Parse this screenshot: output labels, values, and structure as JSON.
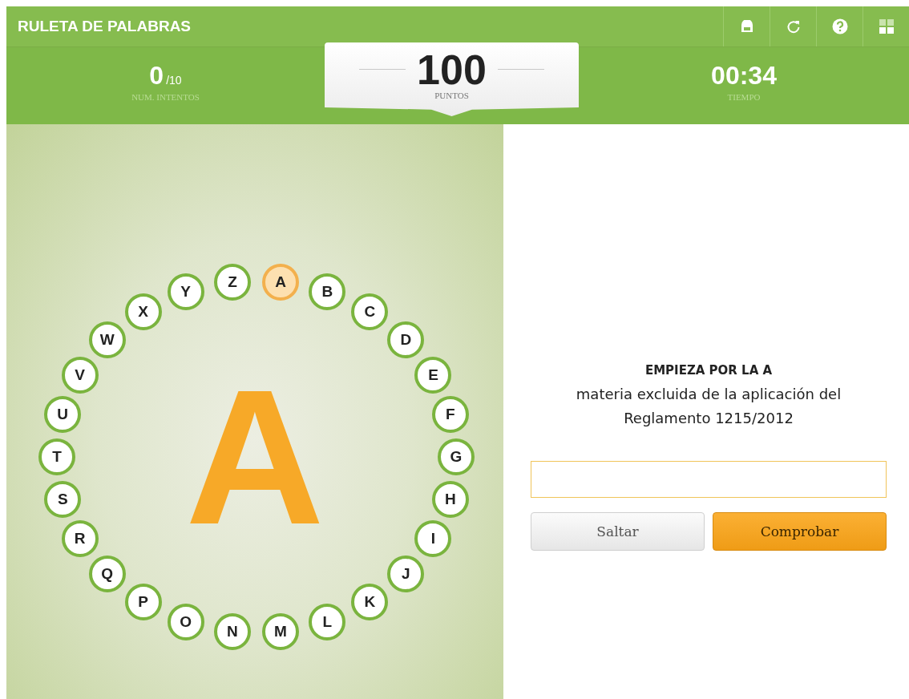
{
  "header": {
    "title": "RULETA DE PALABRAS",
    "tools": [
      {
        "kind": "print"
      },
      {
        "kind": "restart"
      },
      {
        "kind": "help"
      },
      {
        "kind": "menu"
      }
    ]
  },
  "stats": {
    "attempts": {
      "value": "0",
      "total": "/10",
      "label": "NUM. INTENTOS"
    },
    "score": {
      "value": "100",
      "label": "PUNTOS"
    },
    "time": {
      "value": "00:34",
      "label": "TIEMPO"
    }
  },
  "wheel": {
    "current_letter": "A",
    "letters": [
      {
        "letter": "A",
        "selected": true
      },
      {
        "letter": "B",
        "selected": false
      },
      {
        "letter": "C",
        "selected": false
      },
      {
        "letter": "D",
        "selected": false
      },
      {
        "letter": "E",
        "selected": false
      },
      {
        "letter": "F",
        "selected": false
      },
      {
        "letter": "G",
        "selected": false
      },
      {
        "letter": "H",
        "selected": false
      },
      {
        "letter": "I",
        "selected": false
      },
      {
        "letter": "J",
        "selected": false
      },
      {
        "letter": "K",
        "selected": false
      },
      {
        "letter": "L",
        "selected": false
      },
      {
        "letter": "M",
        "selected": false
      },
      {
        "letter": "N",
        "selected": false
      },
      {
        "letter": "O",
        "selected": false
      },
      {
        "letter": "P",
        "selected": false
      },
      {
        "letter": "Q",
        "selected": false
      },
      {
        "letter": "R",
        "selected": false
      },
      {
        "letter": "S",
        "selected": false
      },
      {
        "letter": "T",
        "selected": false
      },
      {
        "letter": "U",
        "selected": false
      },
      {
        "letter": "V",
        "selected": false
      },
      {
        "letter": "W",
        "selected": false
      },
      {
        "letter": "X",
        "selected": false
      },
      {
        "letter": "Y",
        "selected": false
      },
      {
        "letter": "Z",
        "selected": false
      }
    ]
  },
  "question": {
    "heading": "EMPIEZA POR LA A",
    "text": "materia excluida de la aplicación del Reglamento 1215/2012"
  },
  "buttons": [
    {
      "kind": "secondary",
      "label": "Saltar"
    },
    {
      "kind": "primary",
      "label": "Comprobar"
    }
  ]
}
